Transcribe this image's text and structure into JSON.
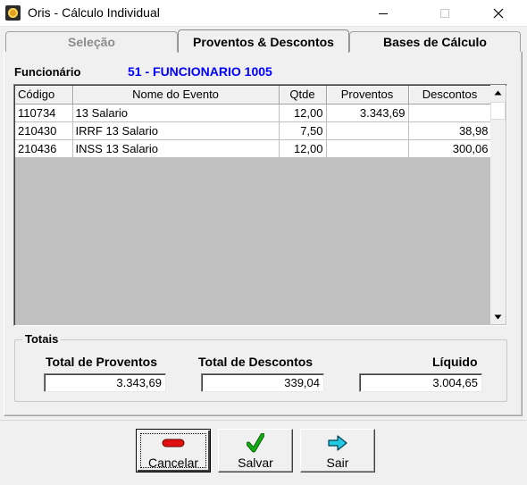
{
  "window": {
    "title": "Oris - Cálculo Individual",
    "app_icon": "oris-app-icon",
    "controls": {
      "minimize": "minimize-icon",
      "maximize": "maximize-icon",
      "close": "close-icon"
    }
  },
  "tabs": [
    {
      "label": "Seleção",
      "state": "disabled"
    },
    {
      "label": "Proventos & Descontos",
      "state": "active"
    },
    {
      "label": "Bases de Cálculo",
      "state": "inactive"
    }
  ],
  "funcionario": {
    "label": "Funcionário",
    "value": "51 - FUNCIONARIO 1005"
  },
  "grid": {
    "columns": [
      "Código",
      "Nome do Evento",
      "Qtde",
      "Proventos",
      "Descontos"
    ],
    "rows": [
      {
        "codigo": "110734",
        "nome": "13 Salario",
        "qtde": "12,00",
        "proventos": "3.343,69",
        "descontos": ""
      },
      {
        "codigo": "210430",
        "nome": "IRRF 13 Salario",
        "qtde": "7,50",
        "proventos": "",
        "descontos": "38,98"
      },
      {
        "codigo": "210436",
        "nome": "INSS 13 Salario",
        "qtde": "12,00",
        "proventos": "",
        "descontos": "300,06"
      }
    ]
  },
  "totais": {
    "legend": "Totais",
    "proventos_label": "Total de Proventos",
    "proventos_value": "3.343,69",
    "descontos_label": "Total de Descontos",
    "descontos_value": "339,04",
    "liquido_label": "Líquido",
    "liquido_value": "3.004,65"
  },
  "buttons": {
    "cancelar": {
      "label": "Cancelar",
      "icon": "minus-icon",
      "color": "#e01010"
    },
    "salvar": {
      "label": "Salvar",
      "icon": "checkmark-icon",
      "color": "#10a010"
    },
    "sair": {
      "label": "Sair",
      "icon": "arrow-right-icon",
      "color": "#20c8e0"
    }
  },
  "colors": {
    "funcionario_value": "#0000ff",
    "grid_empty_area": "#c0c0c0"
  }
}
